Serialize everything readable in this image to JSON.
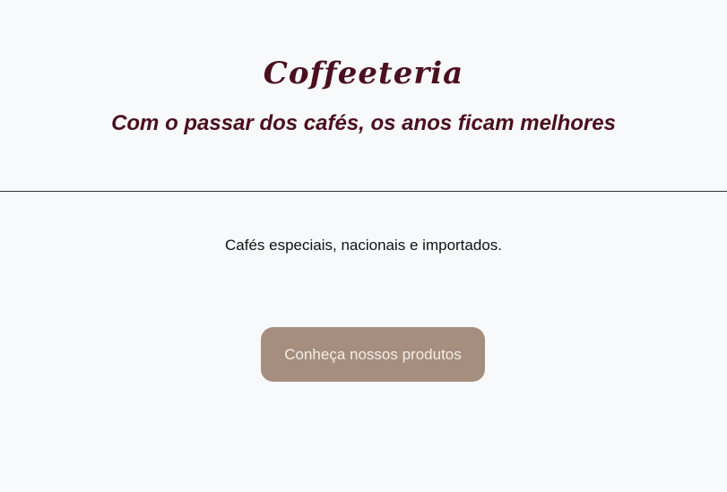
{
  "header": {
    "logo_text": "Coffeeteria",
    "tagline": "Com o passar dos cafés, os anos ficam melhores"
  },
  "main": {
    "description": "Cafés especiais, nacionais e importados.",
    "cta_label": "Conheça nossos produtos"
  },
  "colors": {
    "brand": "#4b0f1f",
    "button_bg": "#a68e7e",
    "button_text": "#f3eee9",
    "page_bg": "#f8f9fa"
  }
}
